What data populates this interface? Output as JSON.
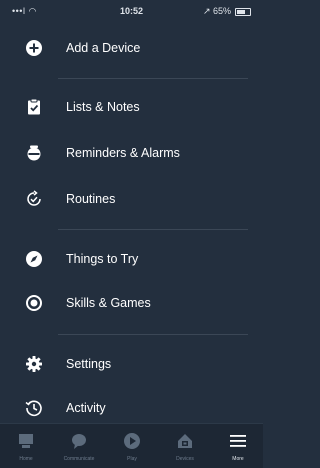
{
  "status_bar": {
    "signal": "•••l ◠",
    "time": "10:52",
    "battery": "↗ 65%"
  },
  "menu": {
    "items": [
      {
        "label": "Add a Device",
        "icon": "add-icon"
      },
      {
        "label": "Lists & Notes",
        "icon": "clipboard-icon"
      },
      {
        "label": "Reminders & Alarms",
        "icon": "alarm-icon"
      },
      {
        "label": "Routines",
        "icon": "routines-icon"
      },
      {
        "label": "Things to Try",
        "icon": "compass-icon"
      },
      {
        "label": "Skills & Games",
        "icon": "skills-icon"
      },
      {
        "label": "Settings",
        "icon": "gear-icon"
      },
      {
        "label": "Activity",
        "icon": "history-icon"
      }
    ]
  },
  "bottom_nav": {
    "tabs": [
      {
        "label": "Home",
        "icon": "home-icon"
      },
      {
        "label": "Communicate",
        "icon": "chat-bubble-icon"
      },
      {
        "label": "Play",
        "icon": "play-icon"
      },
      {
        "label": "Devices",
        "icon": "devices-icon"
      },
      {
        "label": "More",
        "icon": "menu-icon"
      }
    ],
    "active": "More"
  },
  "colors": {
    "background": "#232f3e",
    "divider": "#3b4756",
    "nav_background": "#1d2734",
    "text": "#ffffff",
    "inactive_icon": "#6e7c8d"
  }
}
